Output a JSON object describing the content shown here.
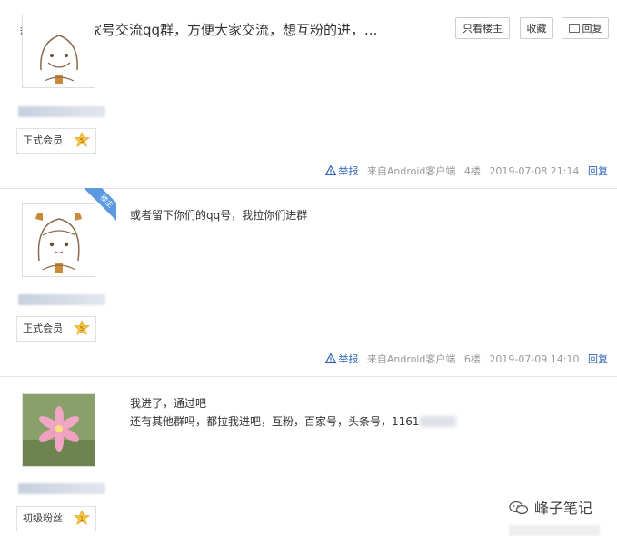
{
  "header": {
    "title": "新建了个百家号交流qq群，方便大家交流，想互粉的进，...",
    "buttons": {
      "only_op": "只看楼主",
      "favorite": "收藏",
      "reply": "回复"
    }
  },
  "posts": [
    {
      "rank": "正式会员",
      "level": "5",
      "content": "",
      "meta": {
        "report": "举报",
        "source": "来自Android客户端",
        "floor": "4楼",
        "time": "2019-07-08 21:14",
        "reply": "回复"
      }
    },
    {
      "badge": "楼主",
      "rank": "正式会员",
      "level": "5",
      "content": "或者留下你们的qq号，我拉你们进群",
      "meta": {
        "report": "举报",
        "source": "来自Android客户端",
        "floor": "6楼",
        "time": "2019-07-09 14:10",
        "reply": "回复"
      }
    },
    {
      "rank": "初级粉丝",
      "level": "1",
      "content_line1": "我进了，通过吧",
      "content_line2": "还有其他群吗，都拉我进吧，互粉，百家号，头条号，1161"
    }
  ],
  "watermark": "峰子笔记",
  "colors": {
    "link": "#2d64b3",
    "badge": "#5b9ae0",
    "star": "#f4c542",
    "border": "#e5e5e5"
  }
}
